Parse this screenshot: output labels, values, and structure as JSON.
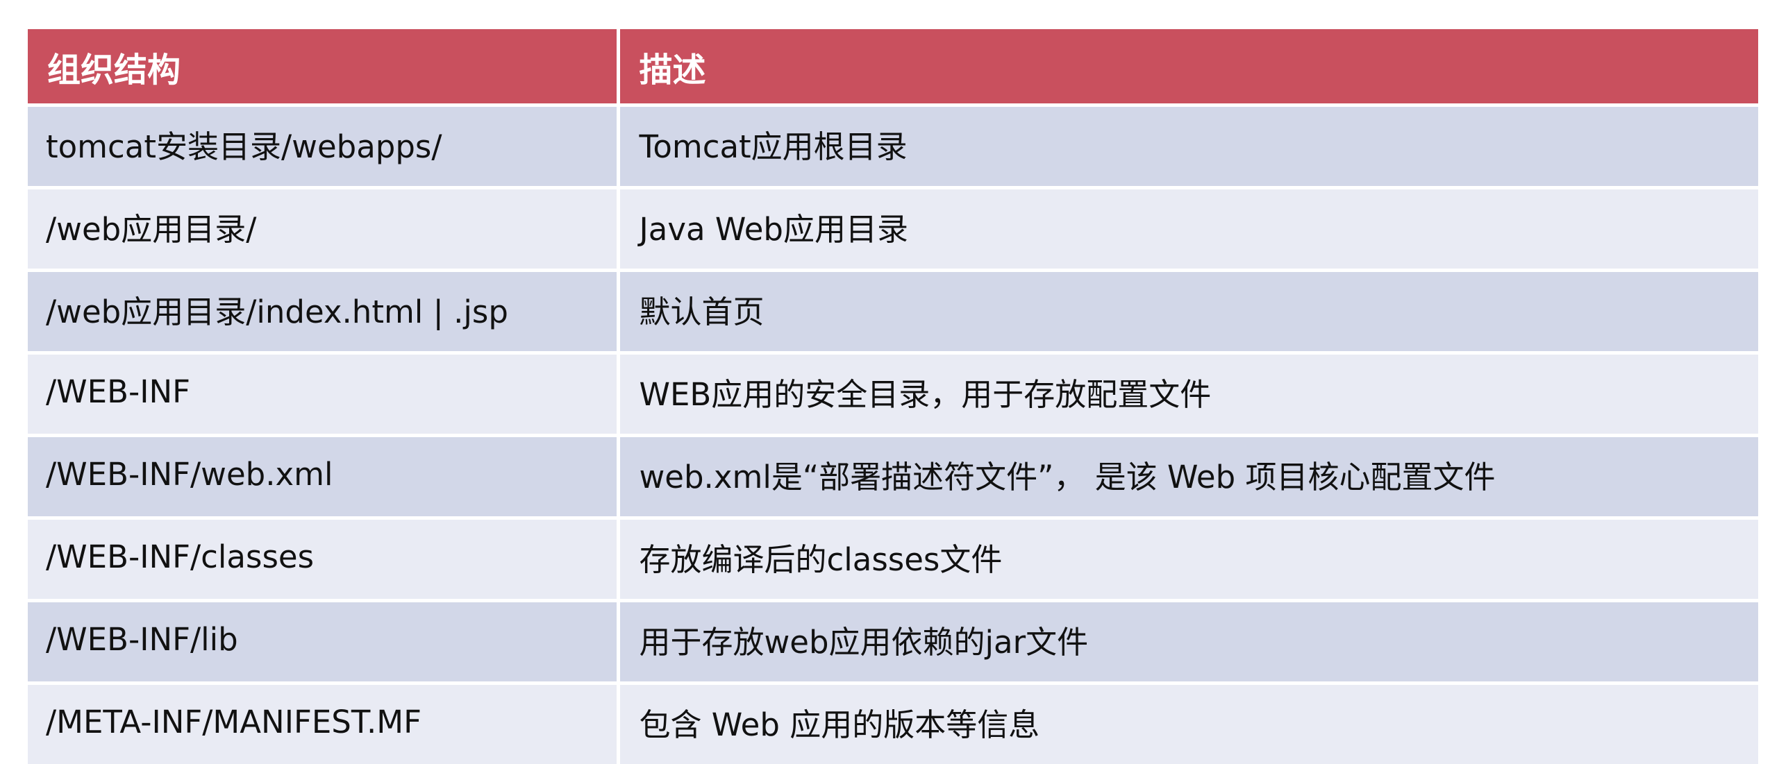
{
  "table": {
    "headers": [
      "组织结构",
      "描述"
    ],
    "rows": [
      [
        "tomcat安装目录/webapps/",
        "Tomcat应用根目录"
      ],
      [
        "/web应用目录/",
        "Java Web应用目录"
      ],
      [
        "/web应用目录/index.html | .jsp",
        "默认首页"
      ],
      [
        "/WEB-INF",
        "WEB应用的安全目录，用于存放配置文件"
      ],
      [
        "/WEB-INF/web.xml",
        "web.xml是“部署描述符文件”， 是该 Web 项目核心配置文件"
      ],
      [
        "/WEB-INF/classes",
        "存放编译后的classes文件"
      ],
      [
        "/WEB-INF/lib",
        "用于存放web应用依赖的jar文件"
      ],
      [
        "/META-INF/MANIFEST.MF",
        "包含 Web 应用的版本等信息"
      ]
    ]
  },
  "colors": {
    "header_bg": "#c9505e",
    "row_dark_bg": "#d2d7e8",
    "row_light_bg": "#e9ebf4",
    "header_text": "#ffffff",
    "body_text": "#111111"
  }
}
